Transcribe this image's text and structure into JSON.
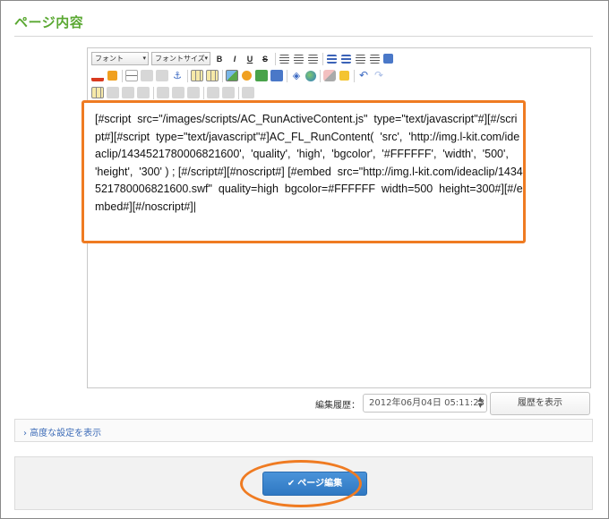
{
  "page": {
    "title": "ページ内容"
  },
  "toolbar": {
    "font_select": "フォント",
    "font_size_select": "フォントサイズ",
    "bold": "B",
    "italic": "I",
    "underline": "U",
    "strike": "S"
  },
  "editor": {
    "content": "[#script  src=\"/images/scripts/AC_RunActiveContent.js\"  type=\"text/javascript\"#][#/script#][#script  type=\"text/javascript\"#]AC_FL_RunContent(  'src',  'http://img.l-kit.com/ideaclip/1434521780006821600',  'quality',  'high',  'bgcolor',  '#FFFFFF',  'width',  '500',  'height',  '300' ) ; [#/script#][#noscript#] [#embed  src=\"http://img.l-kit.com/ideaclip/1434521780006821600.swf\"  quality=high  bgcolor=#FFFFFF  width=500  height=300#][#/embed#][#/noscript#]|"
  },
  "history": {
    "label": "編集履歴：",
    "selected": "2012年06月04日 05:11:23",
    "button": "履歴を表示"
  },
  "advanced": {
    "label": "› 高度な設定を表示"
  },
  "footer": {
    "check_icon": "✔",
    "edit_button": "ページ編集"
  },
  "colors": {
    "accent_green": "#5aa832",
    "highlight_orange": "#ef7b22",
    "primary_blue": "#3380c8"
  }
}
